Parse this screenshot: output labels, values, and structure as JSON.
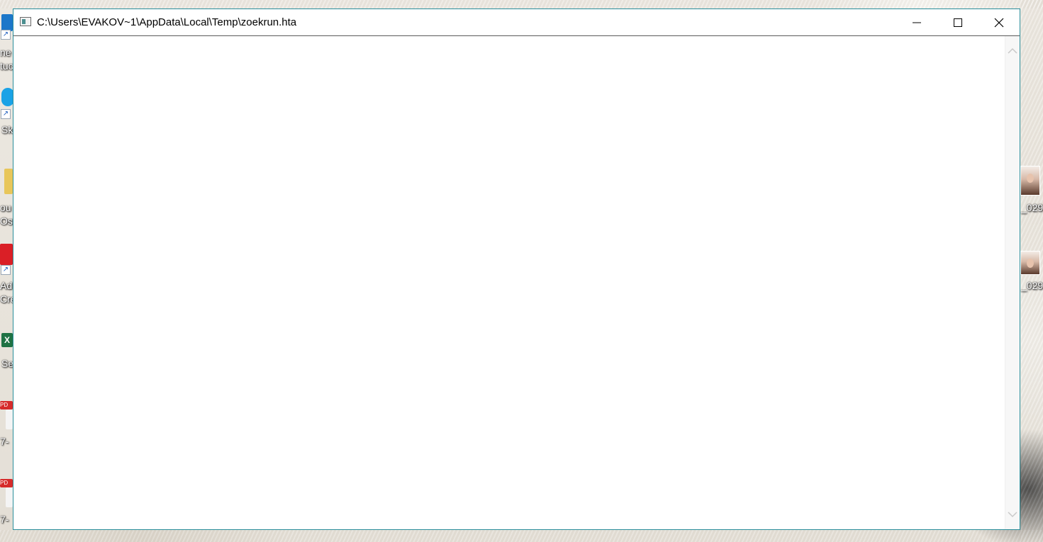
{
  "window": {
    "title": "C:\\Users\\EVAKOV~1\\AppData\\Local\\Temp\\zoekrun.hta",
    "icon": "hta-window-icon",
    "controls": {
      "minimize_icon": "minimize-icon",
      "maximize_icon": "maximize-icon",
      "close_icon": "close-icon"
    },
    "scrollbar": {
      "up_icon": "chevron-up-icon",
      "down_icon": "chevron-down-icon"
    }
  },
  "desktop": {
    "left_icons": [
      {
        "label_line1": "ne",
        "label_line2": "tuc",
        "icon": "app-shortcut-icon"
      },
      {
        "label_line1": "Sk",
        "label_line2": "",
        "icon": "skype-icon"
      },
      {
        "label_line1": "ou",
        "label_line2": "Ost",
        "icon": "folder-icon"
      },
      {
        "label_line1": "Ad",
        "label_line2": "Cre",
        "icon": "adobe-creative-cloud-icon"
      },
      {
        "label_line1": "Se",
        "label_line2": "",
        "icon": "excel-icon"
      },
      {
        "label_line1": "7-",
        "label_line2": "",
        "icon": "pdf-icon"
      },
      {
        "label_line1": "7-",
        "label_line2": "",
        "icon": "pdf-icon"
      }
    ],
    "right_icons": [
      {
        "label": "_029",
        "icon": "photo-icon"
      },
      {
        "label": "_029",
        "icon": "photo-icon"
      }
    ]
  },
  "colors": {
    "window_border": "#2a8e9b",
    "titlebar_bg": "#ffffff",
    "client_bg": "#ffffff",
    "close_hover": "#e81123"
  }
}
